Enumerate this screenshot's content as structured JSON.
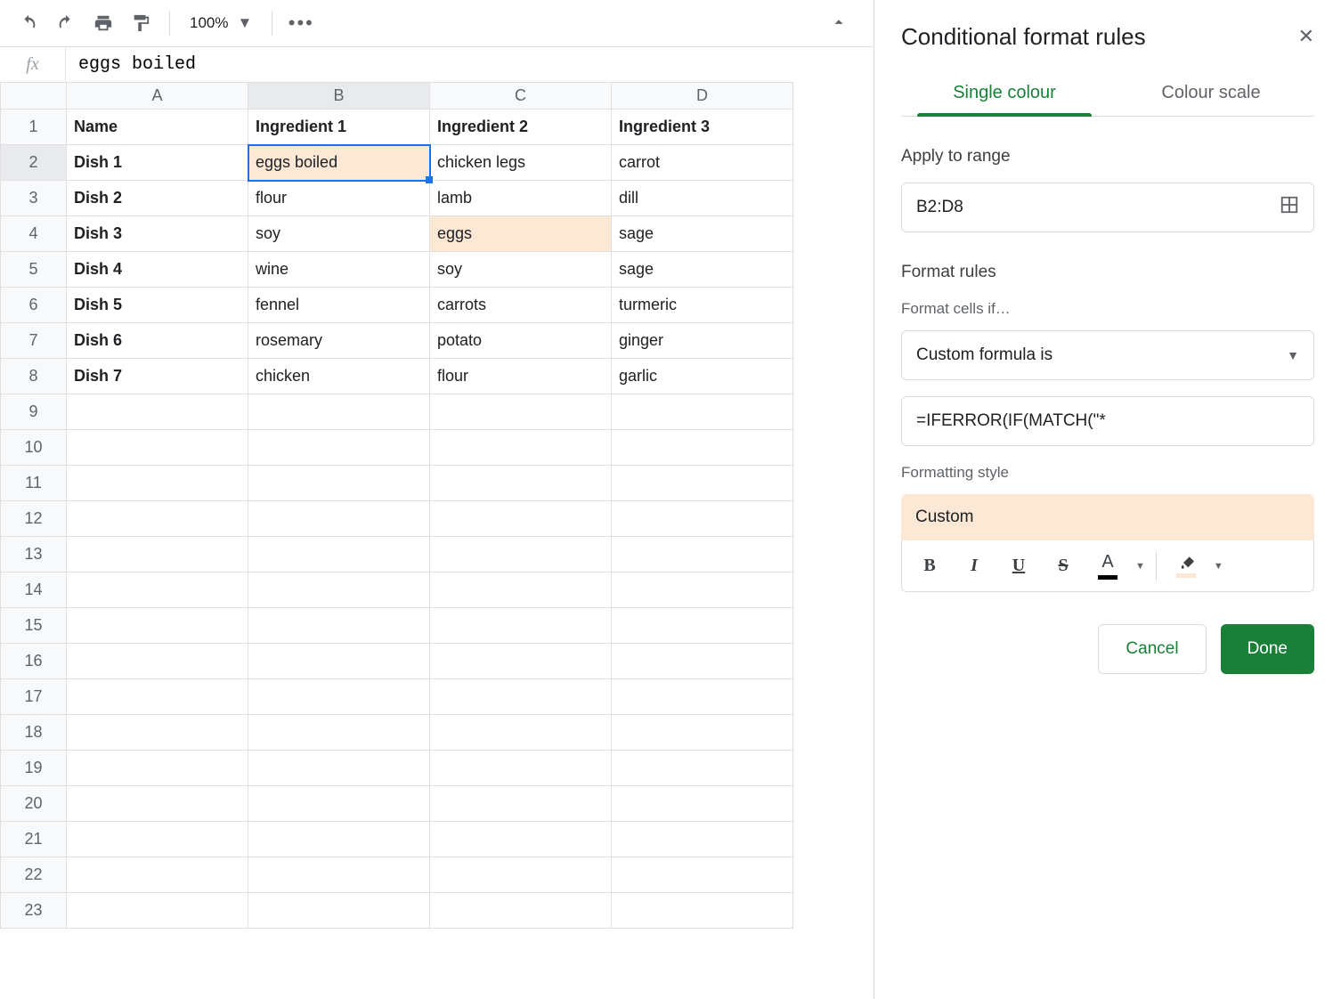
{
  "toolbar": {
    "zoom": "100%"
  },
  "formula_bar": {
    "fx": "fx",
    "value": "eggs boiled"
  },
  "columns": [
    "A",
    "B",
    "C",
    "D"
  ],
  "row_numbers": [
    1,
    2,
    3,
    4,
    5,
    6,
    7,
    8,
    9,
    10,
    11,
    12,
    13,
    14,
    15,
    16,
    17,
    18,
    19,
    20,
    21,
    22,
    23
  ],
  "header_row": [
    "Name",
    "Ingredient 1",
    "Ingredient 2",
    "Ingredient 3"
  ],
  "rows": [
    [
      "Dish 1",
      "eggs boiled",
      "chicken legs",
      "carrot"
    ],
    [
      "Dish 2",
      "flour",
      "lamb",
      "dill"
    ],
    [
      "Dish 3",
      "soy",
      "eggs",
      "sage"
    ],
    [
      "Dish 4",
      "wine",
      "soy",
      "sage"
    ],
    [
      "Dish 5",
      "fennel",
      "carrots",
      "turmeric"
    ],
    [
      "Dish 6",
      "rosemary",
      "potato",
      "ginger"
    ],
    [
      "Dish 7",
      "chicken",
      "flour",
      "garlic"
    ]
  ],
  "highlighted": [
    [
      0,
      1
    ],
    [
      2,
      2
    ]
  ],
  "active_cell": [
    0,
    1
  ],
  "sidebar": {
    "title": "Conditional format rules",
    "tabs": {
      "single": "Single colour",
      "scale": "Colour scale"
    },
    "apply_label": "Apply to range",
    "range": "B2:D8",
    "format_rules_label": "Format rules",
    "cells_if_label": "Format cells if…",
    "condition": "Custom formula is",
    "formula": "=IFERROR(IF(MATCH(\"*",
    "style_label": "Formatting style",
    "style_name": "Custom",
    "cancel": "Cancel",
    "done": "Done"
  }
}
